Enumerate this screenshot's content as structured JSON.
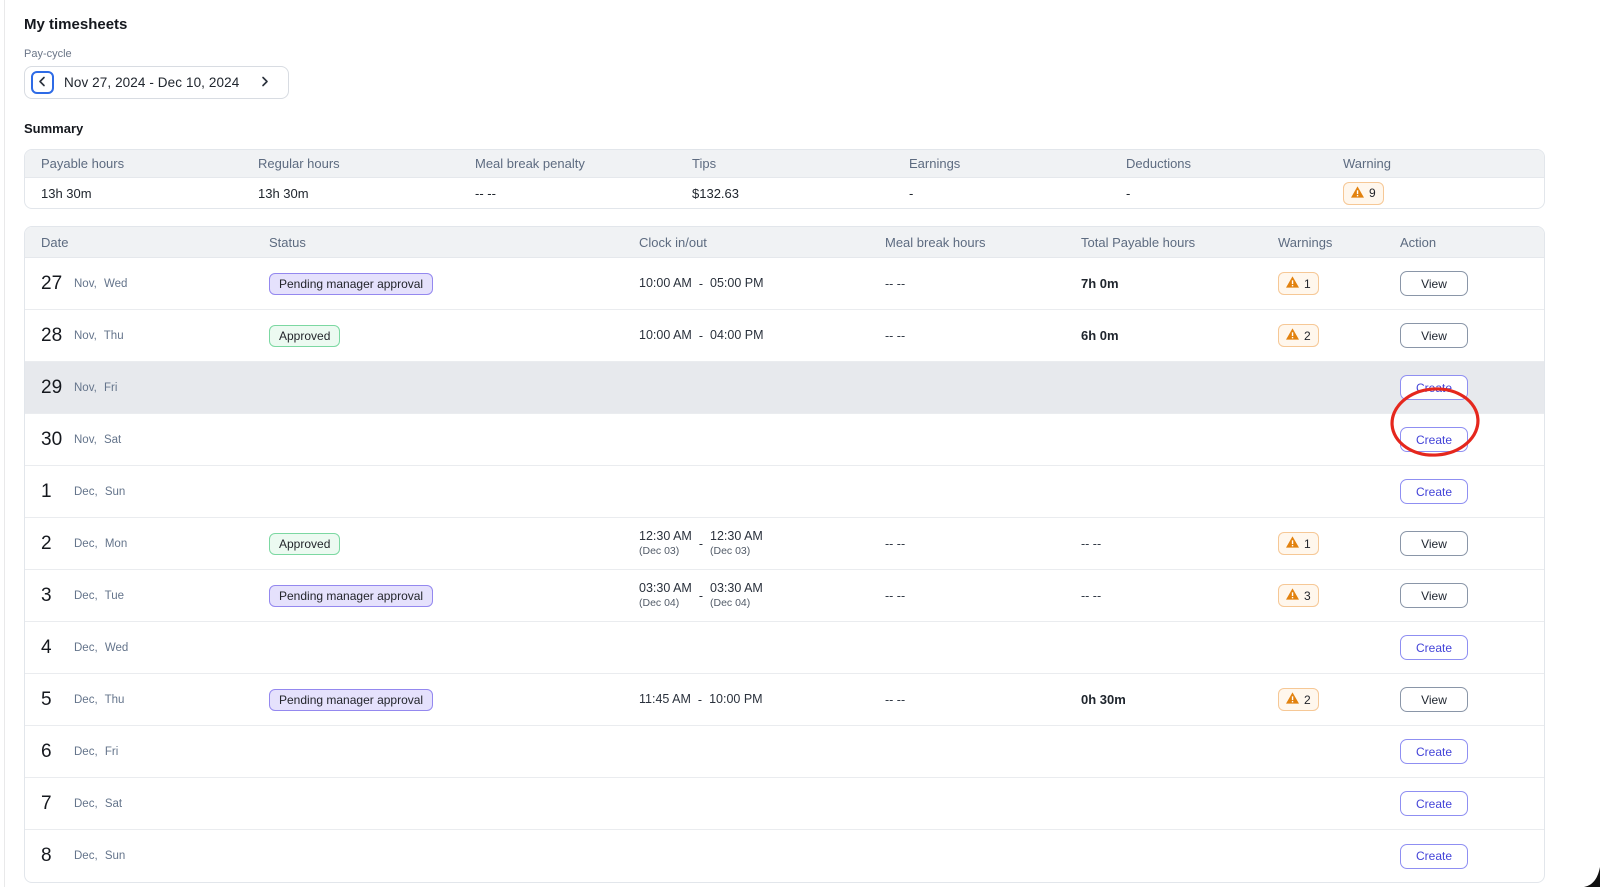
{
  "page": {
    "title": "My timesheets"
  },
  "pay_cycle": {
    "label": "Pay-cycle",
    "value": "Nov 27, 2024 - Dec 10, 2024"
  },
  "summary": {
    "title": "Summary",
    "columns": [
      "Payable hours",
      "Regular hours",
      "Meal break penalty",
      "Tips",
      "Earnings",
      "Deductions",
      "Warning"
    ],
    "payable_hours": "13h 30m",
    "regular_hours": "13h 30m",
    "meal_break_penalty": "-- --",
    "tips": "$132.63",
    "earnings": "-",
    "deductions": "-",
    "warning_count": "9"
  },
  "table": {
    "columns": [
      "Date",
      "Status",
      "Clock in/out",
      "Meal break hours",
      "Total Payable hours",
      "Warnings",
      "Action"
    ],
    "rows": [
      {
        "day": "27",
        "sub": "Nov, Wed",
        "status": "Pending manager approval",
        "status_type": "pending",
        "clock_in": "10:00 AM",
        "clock_out": "05:00 PM",
        "meal": "-- --",
        "total": "7h 0m",
        "warnings": "1",
        "action": "View"
      },
      {
        "day": "28",
        "sub": "Nov, Thu",
        "status": "Approved",
        "status_type": "approved",
        "clock_in": "10:00 AM",
        "clock_out": "04:00 PM",
        "meal": "-- --",
        "total": "6h 0m",
        "warnings": "2",
        "action": "View"
      },
      {
        "day": "29",
        "sub": "Nov, Fri",
        "action": "Create",
        "highlighted": true
      },
      {
        "day": "30",
        "sub": "Nov, Sat",
        "action": "Create",
        "annotated": true
      },
      {
        "day": "1",
        "sub": "Dec, Sun",
        "action": "Create"
      },
      {
        "day": "2",
        "sub": "Dec, Mon",
        "status": "Approved",
        "status_type": "approved",
        "clock_in": "12:30 AM",
        "clock_in_sub": "(Dec 03)",
        "clock_out": "12:30 AM",
        "clock_out_sub": "(Dec 03)",
        "meal": "-- --",
        "total": "-- --",
        "warnings": "1",
        "action": "View"
      },
      {
        "day": "3",
        "sub": "Dec, Tue",
        "status": "Pending manager approval",
        "status_type": "pending",
        "clock_in": "03:30 AM",
        "clock_in_sub": "(Dec 04)",
        "clock_out": "03:30 AM",
        "clock_out_sub": "(Dec 04)",
        "meal": "-- --",
        "total": "-- --",
        "warnings": "3",
        "action": "View"
      },
      {
        "day": "4",
        "sub": "Dec, Wed",
        "action": "Create"
      },
      {
        "day": "5",
        "sub": "Dec, Thu",
        "status": "Pending manager approval",
        "status_type": "pending",
        "clock_in": "11:45 AM",
        "clock_out": "10:00 PM",
        "meal": "-- --",
        "total": "0h 30m",
        "warnings": "2",
        "action": "View"
      },
      {
        "day": "6",
        "sub": "Dec, Fri",
        "action": "Create"
      },
      {
        "day": "7",
        "sub": "Dec, Sat",
        "action": "Create"
      },
      {
        "day": "8",
        "sub": "Dec, Sun",
        "action": "Create"
      }
    ]
  },
  "colors": {
    "accent_purple": "#4343d8",
    "pending_bg": "#e5e1fc",
    "approved_border": "#7cd8a2",
    "warning_orange": "#e2820f",
    "annotation_red": "#e5271d",
    "header_bg": "#f0f2f4",
    "highlight_row_bg": "#e7e9ed"
  }
}
